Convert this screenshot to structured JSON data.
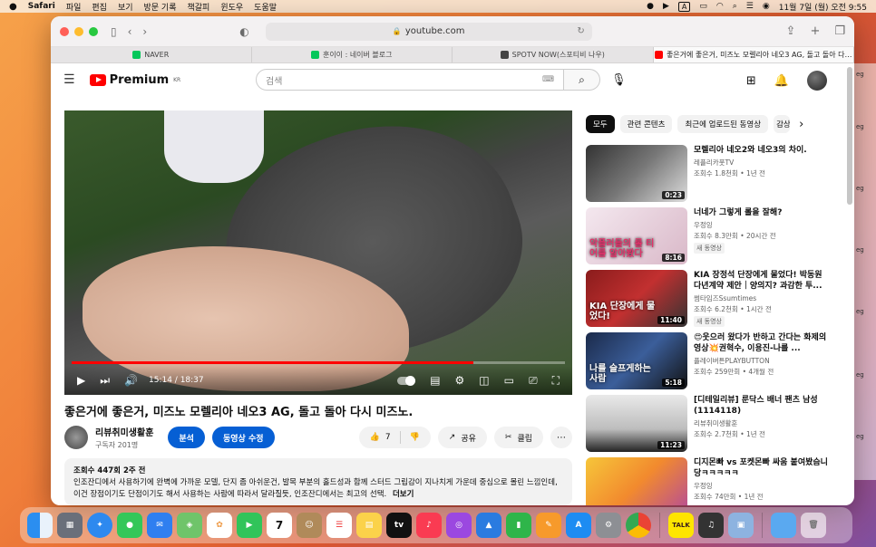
{
  "menubar": {
    "apple": "",
    "items": [
      "Safari",
      "파일",
      "편집",
      "보기",
      "방문 기록",
      "책갈피",
      "윈도우",
      "도움말"
    ],
    "input_indicator": "A",
    "datetime": "11월 7일 (월) 오전 9:55"
  },
  "browser": {
    "url": "youtube.com",
    "tabs": [
      {
        "label": "NAVER",
        "color": "#03c75a"
      },
      {
        "label": "훈이이 : 네이버 블로그",
        "color": "#03c75a"
      },
      {
        "label": "SPOTV NOW(스포티비 나우)",
        "color": "#444444"
      },
      {
        "label": "좋은거에 좋은거, 미즈노 모렐리아 네오3 AG, 돌고 돌아 다…",
        "color": "#ff0000"
      }
    ]
  },
  "yt": {
    "logo_text": "Premium",
    "logo_region": "KR",
    "search_placeholder": "검색"
  },
  "player": {
    "time": "15:14 / 18:37",
    "progress": 0.814
  },
  "video": {
    "title": "좋은거에 좋은거, 미즈노 모렐리아 네오3 AG, 돌고 돌아 다시 미즈노.",
    "channel": "리뷰취미생활훈",
    "subs": "구독자 201명",
    "btn_analysis": "분석",
    "btn_edit": "동영상 수정",
    "likes": "7",
    "share": "공유",
    "clip": "클립",
    "desc_meta": "조회수 447회  2주 전",
    "desc_line1": "인조잔디에서 사용하기에 완벽에 가까운 모델, 단지 좀 아쉬운건, 발목 부분의 홀드성과 함께 스터드 그립감이 지나치게 가운데 중심으로 몰린 느낌인데,",
    "desc_line2": "이건 장점이기도 단점이기도 해서 사용하는 사람에 따라서 달라질듯, 인조잔디에서는 최고의 선택.",
    "desc_more": "더보기"
  },
  "chips": [
    "모두",
    "관련 콘텐츠",
    "최근에 업로드된 동영상",
    "감상"
  ],
  "recs": [
    {
      "title": "모렐리아 네오2와 네오3의 차이.",
      "channel": "레플리카풋TV",
      "stats": "조회수 1.8천회 • 1년 전",
      "duration": "0:23",
      "badge": "",
      "overlay": ""
    },
    {
      "title": "너네가 그렇게 롤을 잘해?",
      "channel": "우정잉",
      "stats": "조회수 8.3만회 • 20시간 전",
      "duration": "8:16",
      "badge": "새 동영상",
      "overlay": "악플러들의 롤 티어를 알아봤다"
    },
    {
      "title": "KIA 장정석 단장에게 물었다! 박동원 다년계약 제안｜양의지? 과감한 투...",
      "channel": "썸타임즈Ssumtimes",
      "stats": "조회수 6.2천회 • 1시간 전",
      "duration": "11:40",
      "badge": "새 동영상",
      "overlay": "KIA 단장에게 물었다!"
    },
    {
      "title": "😍웃으러 왔다가 반하고 간다는 화제의 영상💥권혁수, 이용진-나를 ...",
      "channel": "플레이버튼PLAYBUTTON",
      "stats": "조회수 259만회 • 4개월 전",
      "duration": "5:18",
      "badge": "",
      "overlay": "나를 슬프게하는 사람"
    },
    {
      "title": "[디테일리뷰] 룬닥스 배너 팬츠 남성 (1114118)",
      "channel": "리뷰취미생활훈",
      "stats": "조회수 2.7천회 • 1년 전",
      "duration": "11:23",
      "badge": "",
      "overlay": ""
    },
    {
      "title": "디지몬빠 vs 포켓몬빠 싸움 붙여봤슴니당ㅋㅋㅋㅋㅋ",
      "channel": "우정잉",
      "stats": "조회수 74만회 • 1년 전",
      "duration": "",
      "badge": "",
      "overlay": ""
    }
  ],
  "colors": {
    "accent": "#ff0000",
    "blue": "#065fd4"
  },
  "dock": {
    "calendar_day": "7",
    "apps": [
      "finder",
      "launchpad",
      "safari",
      "messages",
      "mail",
      "maps",
      "photos",
      "facetime",
      "calendar",
      "contacts",
      "reminders",
      "notes",
      "tv",
      "music",
      "podcasts",
      "keynote",
      "numbers",
      "pages",
      "appstore",
      "settings",
      "chrome",
      "kakaotalk",
      "garageband",
      "preview",
      "folder",
      "trash"
    ]
  },
  "bgwin_labels": [
    "eg",
    "eg",
    "eg",
    "eg",
    "eg",
    "eg",
    "eg",
    "eg"
  ]
}
